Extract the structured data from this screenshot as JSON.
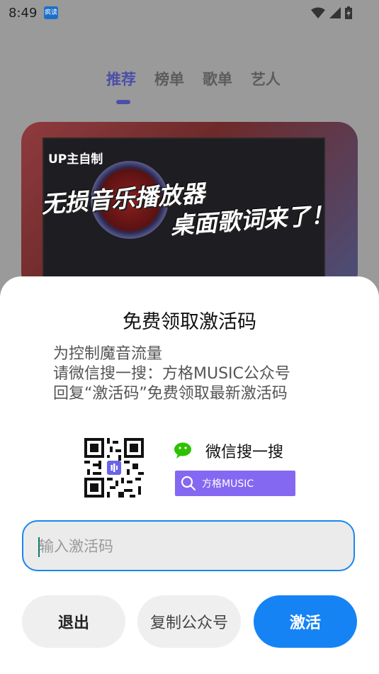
{
  "status_bar": {
    "time": "8:49",
    "notification_badge": "疯读"
  },
  "tabs": [
    {
      "label": "推荐",
      "active": true
    },
    {
      "label": "榜单",
      "active": false
    },
    {
      "label": "歌单",
      "active": false
    },
    {
      "label": "艺人",
      "active": false
    }
  ],
  "banner": {
    "tag": "UP主自制",
    "headline_1": "无损音乐播放器",
    "headline_2": "桌面歌词来了！"
  },
  "dialog": {
    "title": "免费领取激活码",
    "description": [
      "为控制魔音流量",
      "请微信搜一搜：方格MUSIC公众号",
      "回复“激活码”免费领取最新激活码"
    ],
    "wechat_search_label": "微信搜一搜",
    "search_pill_text": "方格MUSIC",
    "input_placeholder": "输入激活码",
    "input_value": "",
    "buttons": {
      "exit": "退出",
      "copy": "复制公众号",
      "activate": "激活"
    }
  },
  "colors": {
    "accent_blue": "#1683f5",
    "tab_active": "#4b4fa8",
    "search_pill": "#8468f2",
    "wechat_green": "#2dc100"
  }
}
